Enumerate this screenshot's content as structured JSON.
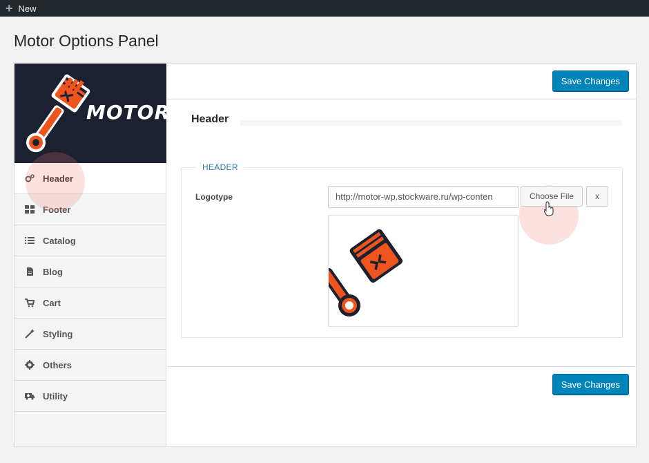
{
  "adminbar": {
    "new_label": "New"
  },
  "page_title": "Motor Options Panel",
  "logo": {
    "text": "MOTOR"
  },
  "sidebar": {
    "items": [
      {
        "label": "Header",
        "icon": "gears-icon"
      },
      {
        "label": "Footer",
        "icon": "grid-icon"
      },
      {
        "label": "Catalog",
        "icon": "list-icon"
      },
      {
        "label": "Blog",
        "icon": "document-icon"
      },
      {
        "label": "Cart",
        "icon": "cart-icon"
      },
      {
        "label": "Styling",
        "icon": "magic-wand-icon"
      },
      {
        "label": "Others",
        "icon": "gear-icon"
      },
      {
        "label": "Utility",
        "icon": "ambulance-icon"
      }
    ]
  },
  "toolbar": {
    "save_label": "Save Changes"
  },
  "section": {
    "title": "Header",
    "legend": "HEADER"
  },
  "logotype": {
    "label": "Logotype",
    "url": "http://motor-wp.stockware.ru/wp-conten",
    "choose_label": "Choose File",
    "remove_label": "x"
  },
  "colors": {
    "accent": "#0085ba",
    "logo_orange": "#f0541e",
    "dark_bg": "#1b2130"
  }
}
